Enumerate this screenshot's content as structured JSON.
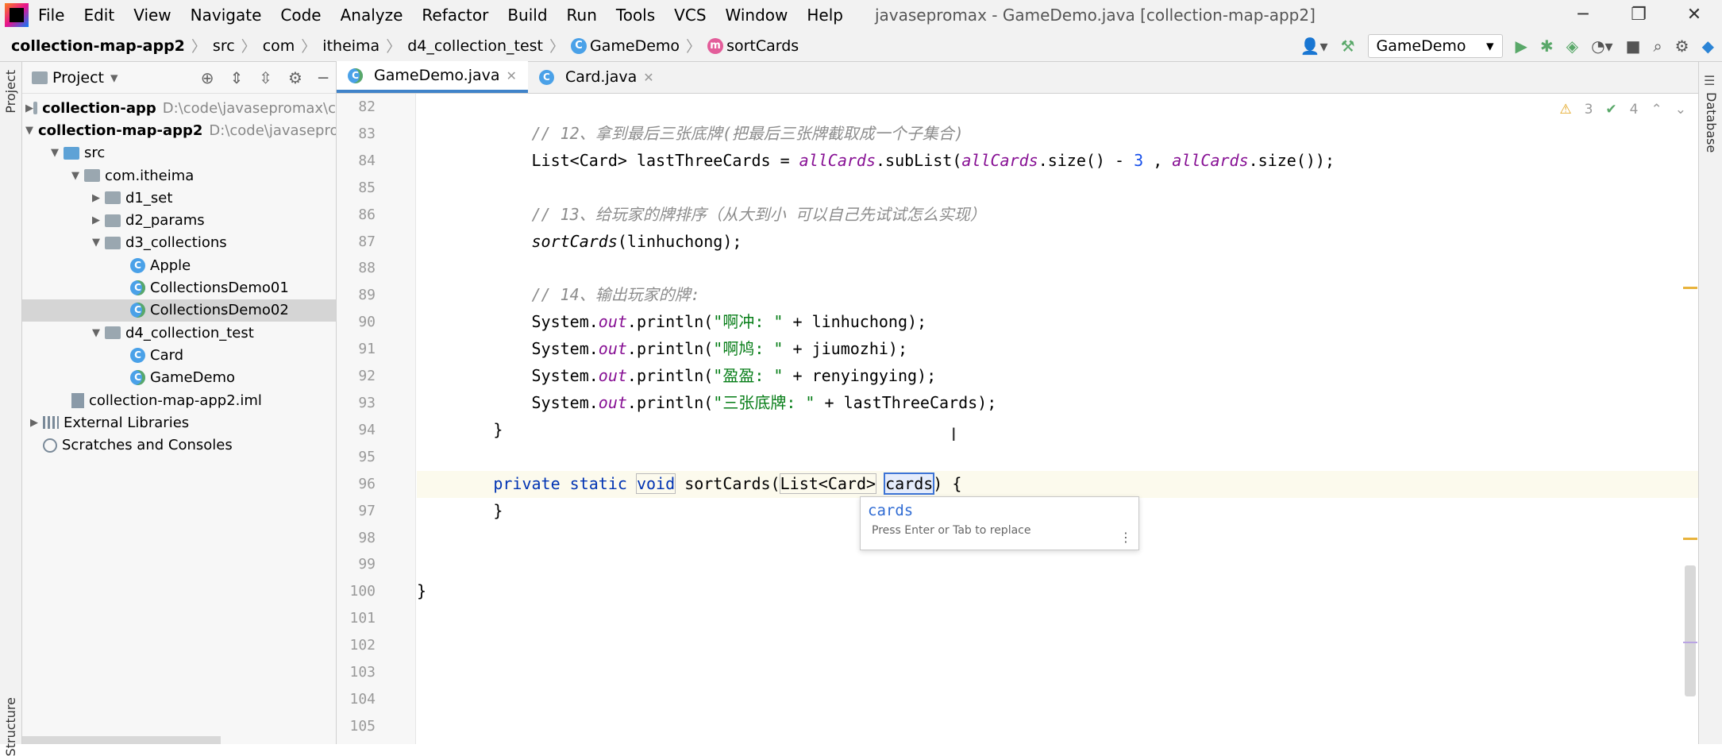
{
  "app": {
    "menu": [
      "File",
      "Edit",
      "View",
      "Navigate",
      "Code",
      "Analyze",
      "Refactor",
      "Build",
      "Run",
      "Tools",
      "VCS",
      "Window",
      "Help"
    ],
    "window_title": "javasepromax - GameDemo.java [collection-map-app2]"
  },
  "breadcrumb": {
    "items": [
      "collection-map-app2",
      "src",
      "com",
      "itheima",
      "d4_collection_test",
      "GameDemo",
      "sortCards"
    ]
  },
  "toolbar": {
    "run_config": "GameDemo"
  },
  "left_stripe": {
    "project_label": "Project",
    "structure_label": "Structure"
  },
  "right_stripe": {
    "database_label": "Database"
  },
  "project_panel": {
    "title": "Project",
    "tree": [
      {
        "label": "collection-app",
        "path": "D:\\code\\javasepromax\\c"
      },
      {
        "label": "collection-map-app2",
        "path": "D:\\code\\javasepro"
      },
      {
        "label": "src"
      },
      {
        "label": "com.itheima"
      },
      {
        "label": "d1_set"
      },
      {
        "label": "d2_params"
      },
      {
        "label": "d3_collections"
      },
      {
        "label": "Apple"
      },
      {
        "label": "CollectionsDemo01"
      },
      {
        "label": "CollectionsDemo02"
      },
      {
        "label": "d4_collection_test"
      },
      {
        "label": "Card"
      },
      {
        "label": "GameDemo"
      },
      {
        "label": "collection-map-app2.iml"
      },
      {
        "label": "External Libraries"
      },
      {
        "label": "Scratches and Consoles"
      }
    ]
  },
  "editor": {
    "tabs": [
      "GameDemo.java",
      "Card.java"
    ],
    "inspections": {
      "warnings": "3",
      "weak_warnings": "4"
    },
    "line_numbers": [
      "82",
      "83",
      "84",
      "85",
      "86",
      "87",
      "88",
      "89",
      "90",
      "91",
      "92",
      "93",
      "94",
      "95",
      "96",
      "97",
      "98",
      "99",
      "100",
      "101",
      "102",
      "103",
      "104",
      "105"
    ],
    "code": {
      "c83": "// 12、拿到最后三张底牌(把最后三张牌截取成一个子集合)",
      "c84_a": "List<Card> lastThreeCards = ",
      "c84_f1": "allCards",
      "c84_b": ".subList(",
      "c84_f2": "allCards",
      "c84_c": ".size() - ",
      "c84_n": "3",
      "c84_d": " , ",
      "c84_f3": "allCards",
      "c84_e": ".size());",
      "c86": "// 13、给玩家的牌排序（从大到小 可以自己先试试怎么实现）",
      "c87_a": "sortCards",
      "c87_b": "(linhuchong);",
      "c89": "// 14、输出玩家的牌:",
      "sys": "System.",
      "out": "out",
      "println": ".println(",
      "s90": "\"啊冲: \"",
      "r90": " + linhuchong);",
      "s91": "\"啊鸠: \"",
      "r91": " + jiumozhi);",
      "s92": "\"盈盈: \"",
      "r92": " + renyingying);",
      "s93": "\"三张底牌: \"",
      "r93": " + lastThreeCards);",
      "brace_close": "}",
      "c96_kw1": "private",
      "c96_kw2": "static",
      "c96_kw3": "void",
      "c96_name": "sortCards(",
      "c96_type": "List<Card>",
      "c96_param": "cards",
      "c96_end": ") {"
    }
  },
  "completion_popup": {
    "suggestion": "cards",
    "hint": "Press Enter or Tab to replace"
  },
  "colors": {
    "keyword": "#0033b3",
    "field": "#871094",
    "string": "#067d17",
    "number": "#1750eb",
    "comment": "#8c8c8c",
    "accent": "#4083c9"
  }
}
